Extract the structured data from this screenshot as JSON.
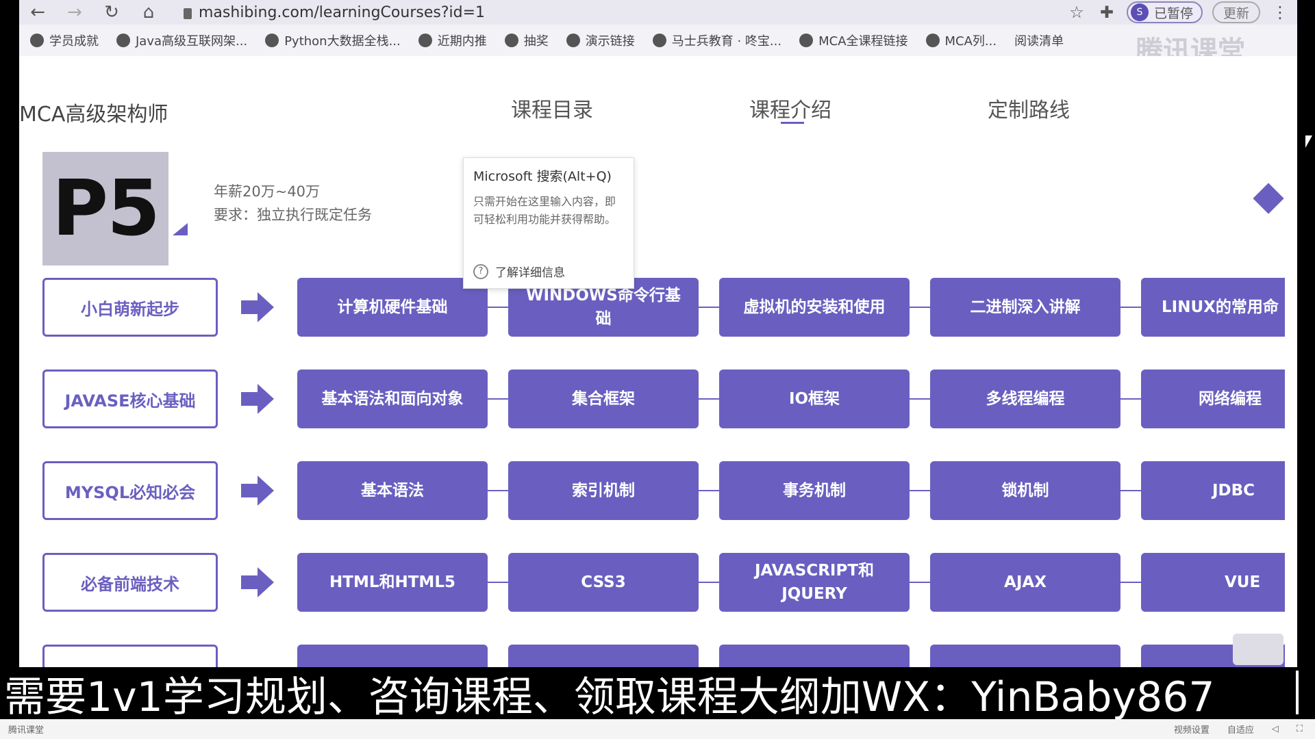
{
  "browser": {
    "url": "mashibing.com/learningCourses?id=1",
    "pause_label": "已暂停",
    "pause_avatar": "S",
    "update_label": "更新"
  },
  "bookmarks": [
    {
      "label": "学员成就"
    },
    {
      "label": "Java高级互联网架..."
    },
    {
      "label": "Python大数据全栈..."
    },
    {
      "label": "近期内推"
    },
    {
      "label": "抽奖"
    },
    {
      "label": "演示链接"
    },
    {
      "label": "马士兵教育 · 咚宝..."
    },
    {
      "label": "MCA全课程链接"
    },
    {
      "label": "MCA列..."
    },
    {
      "label": "阅读清单"
    }
  ],
  "page": {
    "brand": "MCA高级架构师",
    "tabs": [
      "课程目录",
      "课程介绍",
      "定制路线"
    ],
    "active_tab": "课程介绍",
    "level": "P5",
    "salary": "年薪20万~40万",
    "requirement": "要求：独立执行既定任务"
  },
  "tooltip": {
    "title": "Microsoft 搜索(Alt+Q)",
    "body": "只需开始在这里输入内容，即可轻松利用功能并获得帮助。",
    "link": "了解详细信息"
  },
  "rows": [
    {
      "label": "小白萌新起步",
      "items": [
        "计算机硬件基础",
        "WINDOWS命令行基\n础",
        "虚拟机的安装和使用",
        "二进制深入讲解",
        "LINUX的常用命"
      ]
    },
    {
      "label": "JAVASE核心基础",
      "items": [
        "基本语法和面向对象",
        "集合框架",
        "IO框架",
        "多线程编程",
        "网络编程"
      ]
    },
    {
      "label": "MYSQL必知必会",
      "items": [
        "基本语法",
        "索引机制",
        "事务机制",
        "锁机制",
        "JDBC"
      ]
    },
    {
      "label": "必备前端技术",
      "items": [
        "HTML和HTML5",
        "CSS3",
        "JAVASCRIPT和\nJQUERY",
        "AJAX",
        "VUE"
      ]
    }
  ],
  "watermark": "腾讯课堂",
  "banner": "需要1v1学习规划、咨询课程、领取课程大纲加WX：YinBaby867",
  "player": {
    "left": "腾讯课堂",
    "right": [
      "视频设置",
      "自适应",
      "",
      ""
    ]
  },
  "colors": {
    "accent": "#6a5fc0"
  }
}
